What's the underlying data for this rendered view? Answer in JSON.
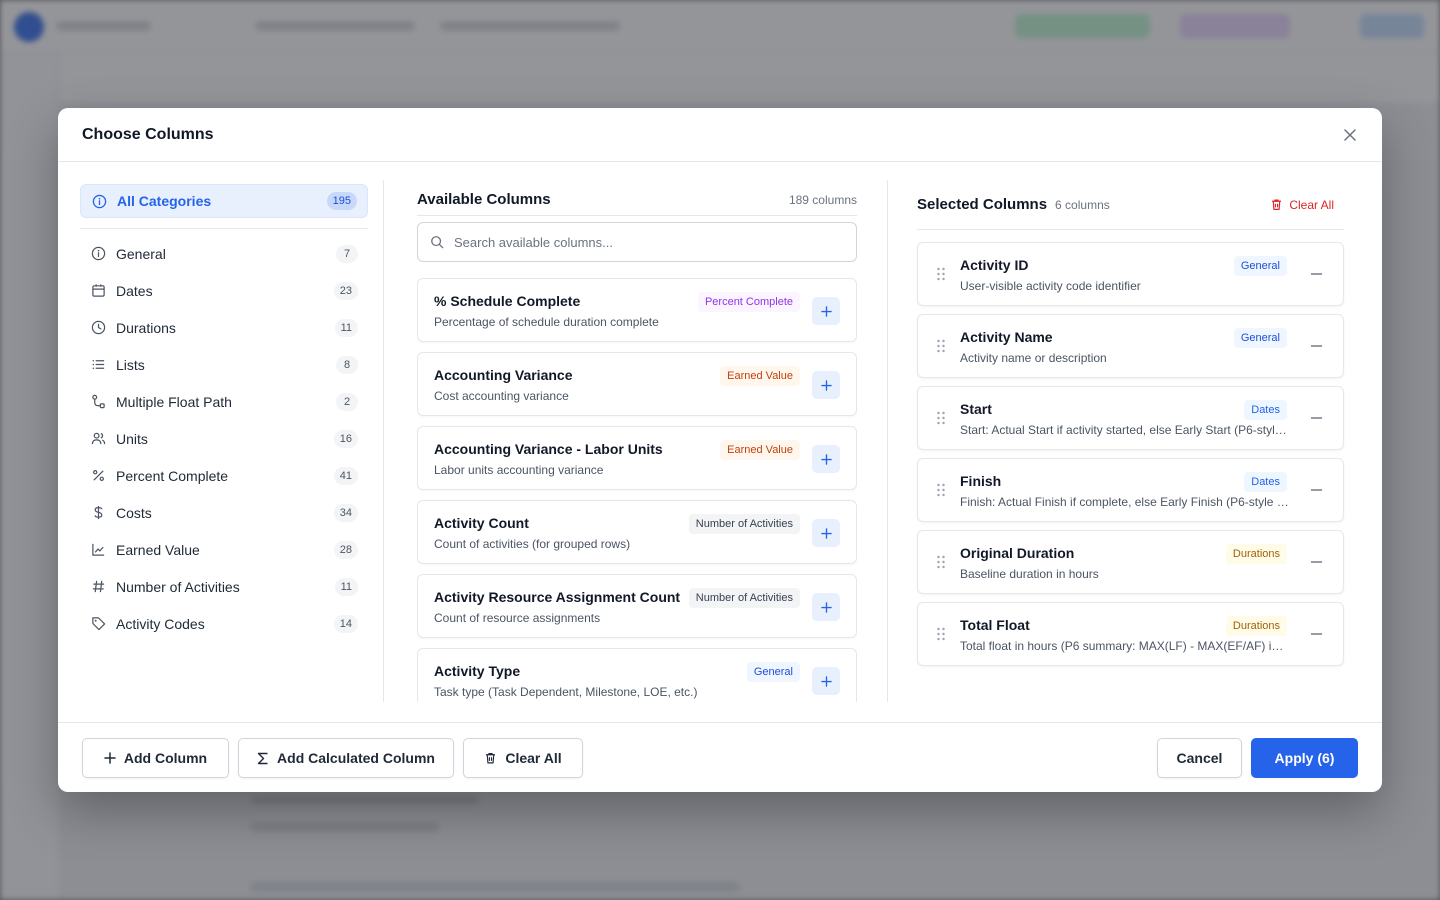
{
  "modal": {
    "title": "Choose Columns"
  },
  "categories": {
    "all": {
      "label": "All Categories",
      "count": "195"
    },
    "items": [
      {
        "label": "General",
        "count": "7",
        "icon": "info-icon"
      },
      {
        "label": "Dates",
        "count": "23",
        "icon": "calendar-icon"
      },
      {
        "label": "Durations",
        "count": "11",
        "icon": "clock-icon"
      },
      {
        "label": "Lists",
        "count": "8",
        "icon": "list-icon"
      },
      {
        "label": "Multiple Float Path",
        "count": "2",
        "icon": "path-icon"
      },
      {
        "label": "Units",
        "count": "16",
        "icon": "users-icon"
      },
      {
        "label": "Percent Complete",
        "count": "41",
        "icon": "percent-icon"
      },
      {
        "label": "Costs",
        "count": "34",
        "icon": "dollar-icon"
      },
      {
        "label": "Earned Value",
        "count": "28",
        "icon": "chart-line-icon"
      },
      {
        "label": "Number of Activities",
        "count": "11",
        "icon": "hash-icon"
      },
      {
        "label": "Activity Codes",
        "count": "14",
        "icon": "tag-icon"
      }
    ]
  },
  "available": {
    "title": "Available Columns",
    "count": "189 columns",
    "search_placeholder": "Search available columns...",
    "items": [
      {
        "name": "% Schedule Complete",
        "desc": "Percentage of schedule duration complete",
        "tag": "Percent Complete"
      },
      {
        "name": "Accounting Variance",
        "desc": "Cost accounting variance",
        "tag": "Earned Value"
      },
      {
        "name": "Accounting Variance - Labor Units",
        "desc": "Labor units accounting variance",
        "tag": "Earned Value"
      },
      {
        "name": "Activity Count",
        "desc": "Count of activities (for grouped rows)",
        "tag": "Number of Activities"
      },
      {
        "name": "Activity Resource Assignment Count",
        "desc": "Count of resource assignments",
        "tag": "Number of Activities"
      },
      {
        "name": "Activity Type",
        "desc": "Task type (Task Dependent, Milestone, LOE, etc.)",
        "tag": "General"
      }
    ]
  },
  "selected": {
    "title": "Selected Columns",
    "count": "6 columns",
    "clear_label": "Clear All",
    "items": [
      {
        "name": "Activity ID",
        "desc": "User-visible activity code identifier",
        "tag": "General"
      },
      {
        "name": "Activity Name",
        "desc": "Activity name or description",
        "tag": "General"
      },
      {
        "name": "Start",
        "desc": "Start: Actual Start if activity started, else Early Start (P6-style ...",
        "tag": "Dates"
      },
      {
        "name": "Finish",
        "desc": "Finish: Actual Finish if complete, else Early Finish (P6-style cu...",
        "tag": "Dates"
      },
      {
        "name": "Original Duration",
        "desc": "Baseline duration in hours",
        "tag": "Durations"
      },
      {
        "name": "Total Float",
        "desc": "Total float in hours (P6 summary: MAX(LF) - MAX(EF/AF) in ...",
        "tag": "Durations"
      }
    ]
  },
  "footer": {
    "add_column": "Add Column",
    "add_calculated": "Add Calculated Column",
    "clear_all": "Clear All",
    "cancel": "Cancel",
    "apply": "Apply (6)"
  },
  "colors": {
    "accent": "#2563eb",
    "danger": "#dc2626"
  }
}
